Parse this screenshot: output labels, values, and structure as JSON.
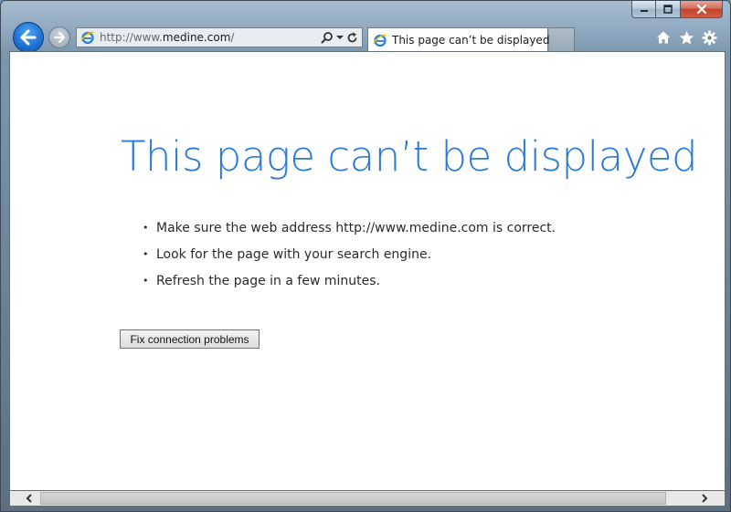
{
  "browser": {
    "address": {
      "scheme": "http://www.",
      "host": "medine.com",
      "path": "/"
    },
    "tab": {
      "title": "This page can’t be displayed"
    },
    "icons": {
      "back": "arrow-left-icon",
      "forward": "arrow-right-icon",
      "search": "search-icon",
      "dropdown": "chevron-down-icon",
      "refresh": "refresh-icon",
      "tab_close": "close-icon",
      "home": "home-icon",
      "favorites": "star-icon",
      "tools": "gear-icon"
    },
    "colors": {
      "accent": "#2b7bd6",
      "back_button": "#1d6fd0",
      "close_button": "#c3422b"
    }
  },
  "page": {
    "title": "This page can’t be displayed",
    "suggestions": [
      "Make sure the web address http://www.medine.com is correct.",
      "Look for the page with your search engine.",
      "Refresh the page in a few minutes."
    ],
    "fix_button_label": "Fix connection problems"
  }
}
